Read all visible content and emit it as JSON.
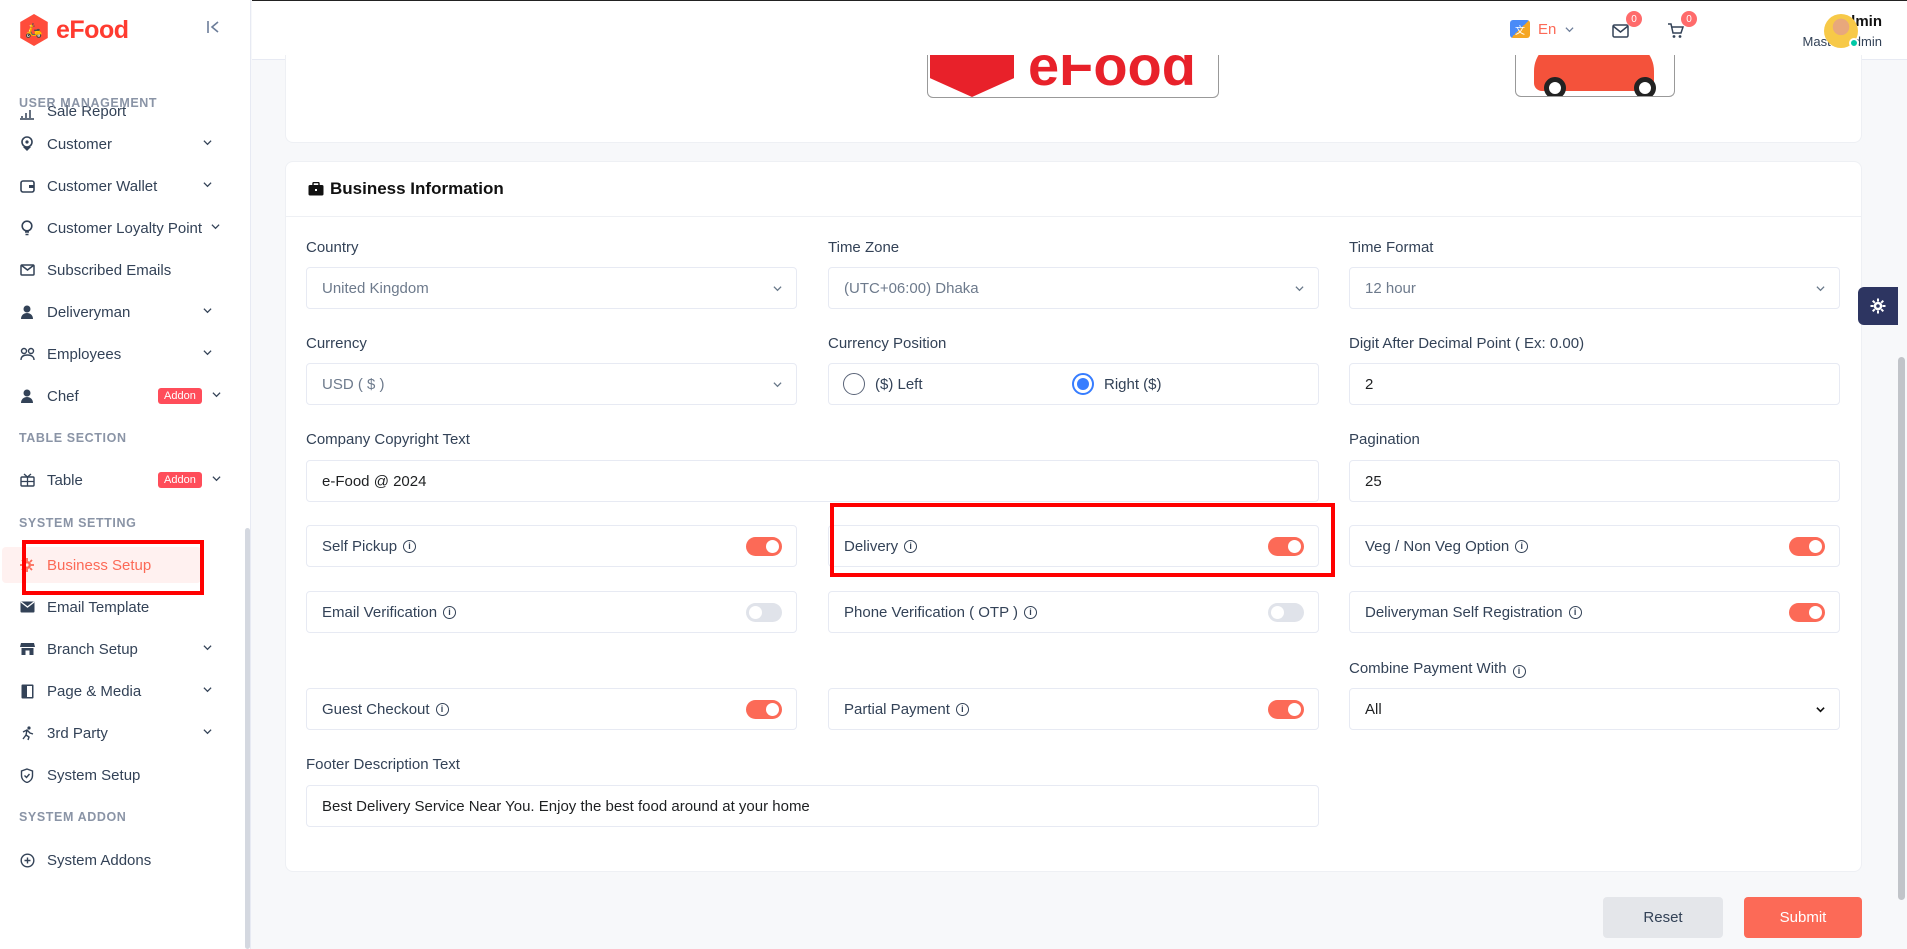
{
  "brand": {
    "name": "eFood"
  },
  "sidebar": {
    "partial_item": "Sale Report",
    "sections": {
      "user_management": "USER MANAGEMENT",
      "table_section": "TABLE SECTION",
      "system_setting": "SYSTEM SETTING",
      "system_addon": "SYSTEM ADDON"
    },
    "items": {
      "customer": "Customer",
      "customer_wallet": "Customer Wallet",
      "customer_loyalty": "Customer Loyalty Point",
      "subscribed_emails": "Subscribed Emails",
      "deliveryman": "Deliveryman",
      "employees": "Employees",
      "chef": "Chef",
      "table": "Table",
      "business_setup": "Business Setup",
      "email_template": "Email Template",
      "branch_setup": "Branch Setup",
      "page_media": "Page & Media",
      "third_party": "3rd Party",
      "system_setup": "System Setup",
      "system_addons": "System Addons"
    },
    "addon_badge": "Addon"
  },
  "topbar": {
    "language": "En",
    "messages_count": "0",
    "cart_count": "0",
    "user_name": "admin",
    "user_role": "Master Admin"
  },
  "business_info": {
    "title": "Business Information",
    "country": {
      "label": "Country",
      "value": "United Kingdom"
    },
    "time_zone": {
      "label": "Time Zone",
      "value": "(UTC+06:00) Dhaka"
    },
    "time_format": {
      "label": "Time Format",
      "value": "12 hour"
    },
    "currency": {
      "label": "Currency",
      "value": "USD ( $ )"
    },
    "currency_position": {
      "label": "Currency Position",
      "left": "($) Left",
      "right": "Right ($)",
      "selected": "right"
    },
    "decimal": {
      "label": "Digit After Decimal Point ( Ex: 0.00)",
      "value": "2"
    },
    "copyright": {
      "label": "Company Copyright Text",
      "value": "e-Food @ 2024"
    },
    "pagination": {
      "label": "Pagination",
      "value": "25"
    },
    "toggles": {
      "self_pickup": {
        "label": "Self Pickup",
        "on": true
      },
      "delivery": {
        "label": "Delivery",
        "on": true
      },
      "veg_nonveg": {
        "label": "Veg / Non Veg Option",
        "on": true
      },
      "email_verification": {
        "label": "Email Verification",
        "on": false
      },
      "phone_verification": {
        "label": "Phone Verification ( OTP )",
        "on": false
      },
      "deliveryman_reg": {
        "label": "Deliveryman Self Registration",
        "on": true
      },
      "guest_checkout": {
        "label": "Guest Checkout",
        "on": true
      },
      "partial_payment": {
        "label": "Partial Payment",
        "on": true
      }
    },
    "combine_payment": {
      "label": "Combine Payment With",
      "value": "All"
    },
    "footer_text": {
      "label": "Footer Description Text",
      "value": "Best Delivery Service Near You. Enjoy the best food around at your home"
    }
  },
  "actions": {
    "reset": "Reset",
    "submit": "Submit"
  },
  "colors": {
    "accent": "#fc6a57",
    "brand": "#ff3b30",
    "highlight_box": "#ff0000",
    "radio": "#377dff"
  }
}
